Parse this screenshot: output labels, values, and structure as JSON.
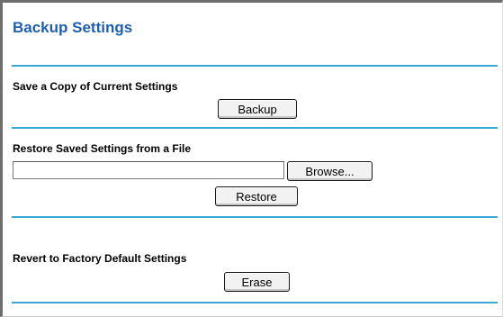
{
  "page": {
    "title": "Backup Settings"
  },
  "sections": {
    "backup": {
      "label": "Save a Copy of Current Settings",
      "button_label": "Backup"
    },
    "restore": {
      "label": "Restore Saved Settings from a File",
      "file_value": "",
      "browse_label": "Browse...",
      "button_label": "Restore"
    },
    "erase": {
      "label": "Revert to Factory Default Settings",
      "button_label": "Erase"
    }
  },
  "colors": {
    "title": "#1f5fb0",
    "rule": "#39a8d8"
  }
}
